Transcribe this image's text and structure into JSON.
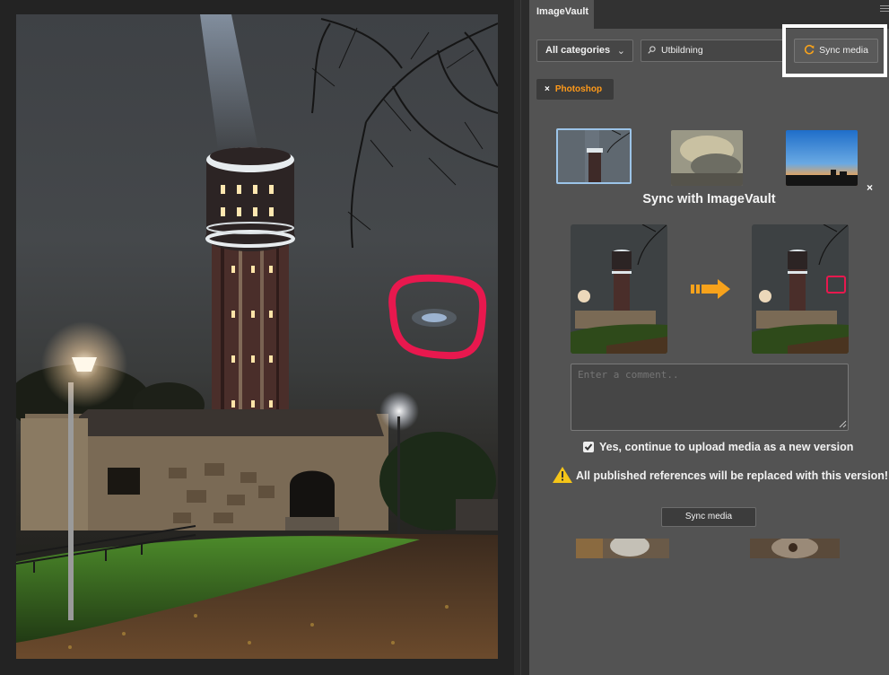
{
  "panel": {
    "tab_label": "ImageVault",
    "category_select": {
      "value": "All categories",
      "chevron": "chevron-down-icon"
    },
    "search": {
      "value": "Utbildning",
      "icon": "search-icon"
    },
    "sync_top_button": {
      "label": "Sync media",
      "icon": "sync-icon",
      "icon_color": "#f7a21b"
    },
    "filter_chip": {
      "remove_glyph": "×",
      "label": "Photoshop",
      "label_color": "#ff9a1a"
    },
    "thumbnails": [
      "water-tower-night",
      "foggy-sky",
      "sunset-skyline"
    ]
  },
  "dialog": {
    "close_glyph": "×",
    "title": "Sync with ImageVault",
    "comment": {
      "value": "",
      "placeholder": "Enter a comment.."
    },
    "confirm_label": "Yes, continue to upload media as a new version",
    "confirm_checked": true,
    "warning_text": "All published references will be replaced with this version!",
    "warning_icon_color": "#f5c518",
    "arrow_color": "#f7a21b",
    "button_label": "Sync media"
  },
  "canvas": {
    "annotation_color": "#e8184e"
  }
}
